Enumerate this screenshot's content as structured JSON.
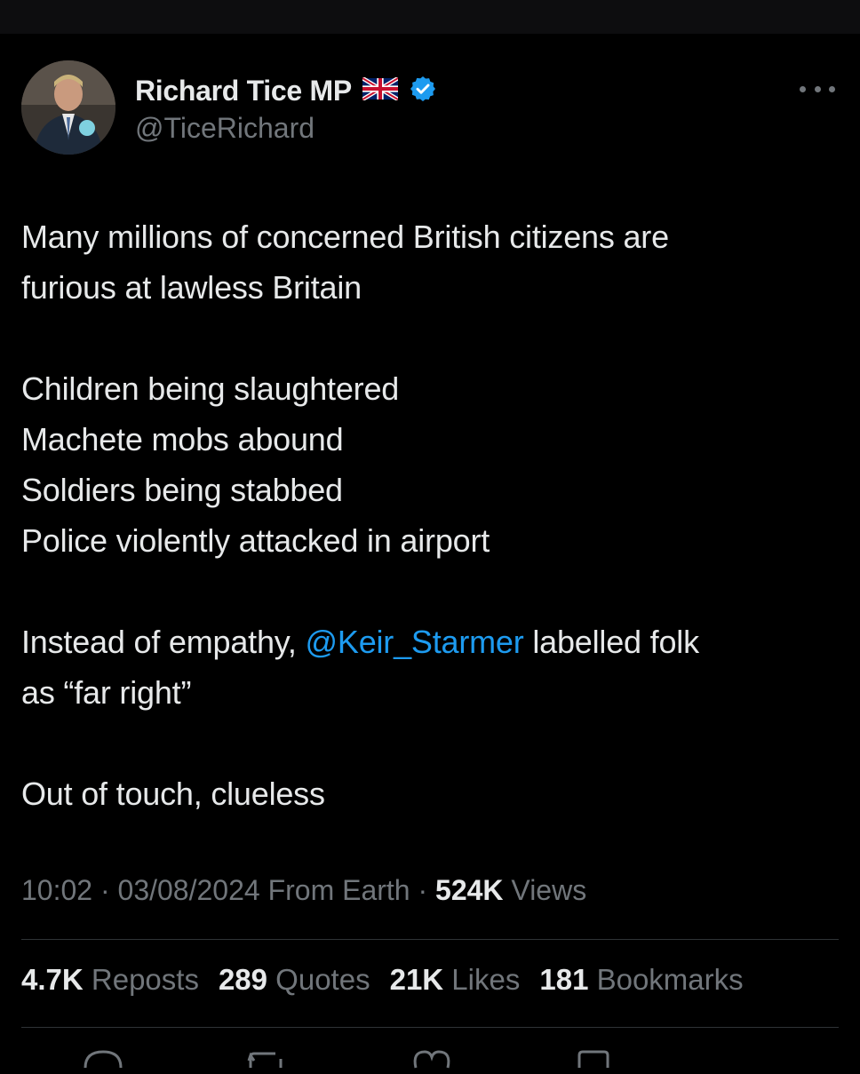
{
  "tweet": {
    "author_name": "Richard Tice MP",
    "handle": "@TiceRichard",
    "flag_icon": "uk-flag-icon",
    "verified_icon": "verified-badge-icon",
    "body": {
      "p1_l1": "Many millions of concerned British citizens are",
      "p1_l2": "furious at lawless Britain",
      "p2_l1": "Children being slaughtered",
      "p2_l2": "Machete mobs abound",
      "p2_l3": "Soldiers being stabbed",
      "p2_l4": "Police violently attacked in airport",
      "p3_pre": "Instead of empathy, ",
      "p3_mention": "@Keir_Starmer",
      "p3_post": " labelled folk",
      "p3_l2": "as “far right”",
      "p4_l1": "Out of touch, clueless"
    },
    "meta": {
      "time": "10:02",
      "sep1": " · ",
      "date": "03/08/2024",
      "source": " From Earth",
      "sep2": " · ",
      "views_count": "524K",
      "views_label": " Views"
    },
    "stats": [
      {
        "count": "4.7K",
        "label": " Reposts"
      },
      {
        "count": "289",
        "label": " Quotes"
      },
      {
        "count": "21K",
        "label": " Likes"
      },
      {
        "count": "181",
        "label": " Bookmarks"
      }
    ]
  },
  "colors": {
    "background": "#000000",
    "text": "#e7e9ea",
    "muted": "#71767b",
    "link": "#1d9bf0",
    "verified": "#1d9bf0",
    "divider": "#2f3336"
  }
}
